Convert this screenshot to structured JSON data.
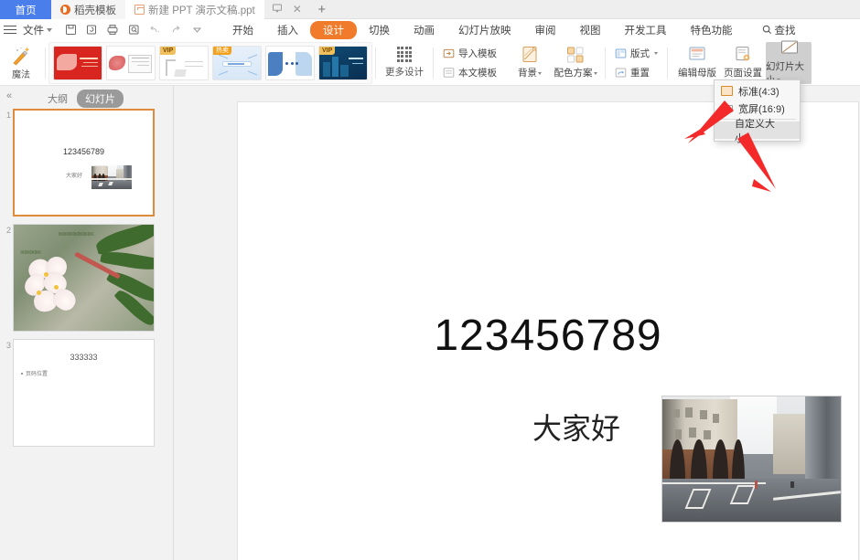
{
  "window": {
    "tabs": [
      {
        "label": "首页",
        "icon": "home-tab",
        "state": "home"
      },
      {
        "label": "稻壳模板",
        "icon": "docer-icon",
        "state": "inactive"
      },
      {
        "label": "新建 PPT 演示文稿.ppt",
        "icon": "ppt-file-icon",
        "state": "active"
      }
    ],
    "tab_icons": {
      "monitor": "⊑",
      "close": "✕",
      "new_tab": "+"
    }
  },
  "menubar": {
    "file_label": "文件",
    "quick_access": [
      "save-icon",
      "save-as-icon",
      "print-icon",
      "print-preview-icon",
      "undo-icon",
      "redo-icon",
      "customize-icon"
    ],
    "items": [
      {
        "label": "开始",
        "active": false
      },
      {
        "label": "插入",
        "active": false
      },
      {
        "label": "设计",
        "active": true
      },
      {
        "label": "切换",
        "active": false
      },
      {
        "label": "动画",
        "active": false
      },
      {
        "label": "幻灯片放映",
        "active": false
      },
      {
        "label": "审阅",
        "active": false
      },
      {
        "label": "视图",
        "active": false
      },
      {
        "label": "开发工具",
        "active": false
      },
      {
        "label": "特色功能",
        "active": false
      }
    ],
    "find_label": "查找"
  },
  "ribbon": {
    "magic_label": "魔法",
    "templates": [
      {
        "badge": "",
        "tone": "red"
      },
      {
        "badge": "",
        "tone": "pink"
      },
      {
        "badge": "VIP",
        "tone": "white"
      },
      {
        "badge": "热卖",
        "tone": "blue"
      },
      {
        "badge": "",
        "tone": "steel"
      },
      {
        "badge": "VIP",
        "tone": "dark"
      }
    ],
    "more_design_label": "更多设计",
    "groups": [
      {
        "items": [
          {
            "label": "导入模板",
            "icon": "import-template-icon"
          },
          {
            "label": "本文模板",
            "icon": "doc-template-icon"
          }
        ]
      },
      {
        "items": [
          {
            "label": "背景",
            "icon": "background-icon",
            "caret": true
          },
          {
            "label": "配色方案",
            "icon": "color-scheme-icon",
            "caret": true
          }
        ]
      },
      {
        "items": [
          {
            "label": "版式",
            "icon": "layout-icon",
            "caret": true
          },
          {
            "label": "重置",
            "icon": "reset-icon"
          }
        ]
      },
      {
        "items": [
          {
            "label": "编辑母版",
            "icon": "edit-master-icon"
          },
          {
            "label": "页面设置",
            "icon": "page-setup-icon"
          },
          {
            "label": "幻灯片大小",
            "icon": "slide-size-icon",
            "caret": true,
            "selected": true
          }
        ]
      }
    ]
  },
  "dropdown": {
    "visible": true,
    "items": [
      {
        "label": "标准(4:3)",
        "icon": "ratio-4-3-icon",
        "selected": true
      },
      {
        "label": "宽屏(16:9)",
        "icon": "ratio-16-9-icon",
        "selected": false
      }
    ],
    "custom_label": "自定义大小..."
  },
  "left_panel": {
    "collapse_icon": "«",
    "tabs": [
      {
        "label": "大纲",
        "active": false
      },
      {
        "label": "幻灯片",
        "active": true
      }
    ],
    "slides": [
      {
        "number": "1",
        "active": true,
        "title": "123456789",
        "subtitle": "大家好",
        "image": "street-photo"
      },
      {
        "number": "2",
        "active": false,
        "image": "flower-photo"
      },
      {
        "number": "3",
        "active": false,
        "title": "333333",
        "bullet": "页码位置"
      }
    ]
  },
  "canvas": {
    "slide": {
      "title": "123456789",
      "subtitle": "大家好",
      "image": "street-photo"
    }
  },
  "annotations": {
    "arrow_color": "#f42a2a",
    "arrows": [
      {
        "name": "arrow-to-slide-size-button"
      },
      {
        "name": "arrow-to-custom-size-item"
      }
    ]
  }
}
